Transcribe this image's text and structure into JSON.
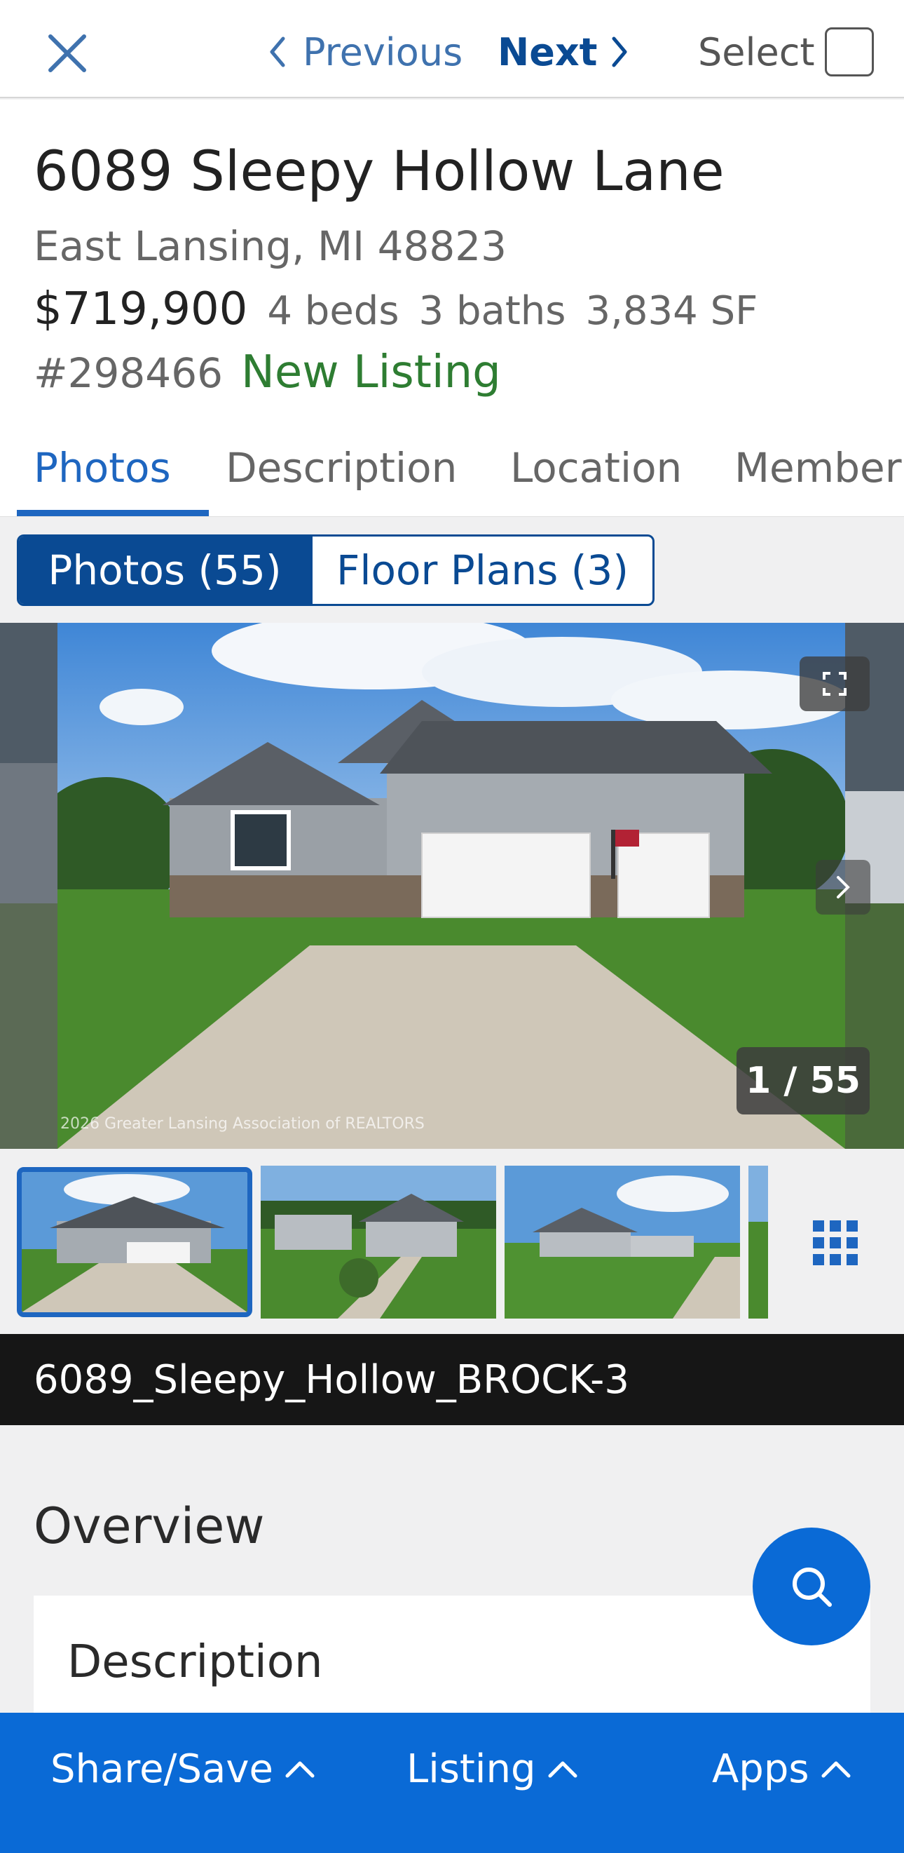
{
  "topbar": {
    "close_icon": "close-icon",
    "previous_label": "Previous",
    "next_label": "Next",
    "select_label": "Select"
  },
  "listing": {
    "address": "6089 Sleepy Hollow Lane",
    "city_state_zip": "East Lansing, MI 48823",
    "price": "$719,900",
    "beds": "4 beds",
    "baths": "3 baths",
    "sqft": "3,834 SF",
    "mls_number": "#298466",
    "status": "New Listing"
  },
  "tabs": [
    {
      "label": "Photos",
      "active": true
    },
    {
      "label": "Description",
      "active": false
    },
    {
      "label": "Location",
      "active": false
    },
    {
      "label": "Member",
      "active": false
    }
  ],
  "media_toggle": {
    "photos_label": "Photos (55)",
    "floorplans_label": "Floor Plans (3)"
  },
  "photo_viewer": {
    "counter": "1 / 55",
    "watermark": "2026 Greater Lansing Association of REALTORS",
    "caption": "6089_Sleepy_Hollow_BROCK-3"
  },
  "overview": {
    "title": "Overview",
    "description_title": "Description"
  },
  "bottom_bar": {
    "share_label": "Share/Save",
    "listing_label": "Listing",
    "apps_label": "Apps"
  },
  "colors": {
    "primary_blue": "#0a6ad6",
    "dark_blue": "#0a4a93",
    "status_green": "#2e7d32"
  }
}
